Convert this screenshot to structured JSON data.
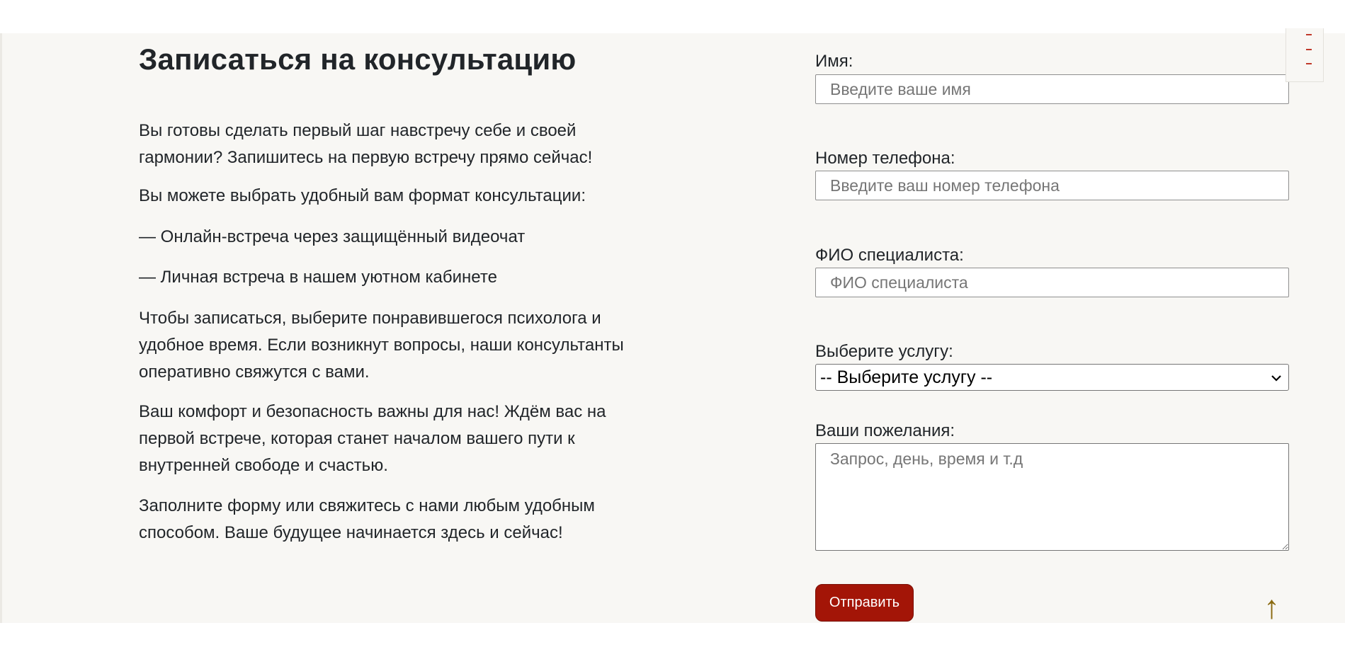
{
  "section": {
    "title": "Записаться на консультацию",
    "paragraphs": [
      "Вы готовы сделать первый шаг навстречу себе и своей гармонии? Запишитесь на первую встречу прямо сейчас!",
      "Вы можете выбрать удобный вам формат консультации:",
      "— Онлайн-встреча через защищённый видеочат",
      "— Личная встреча в нашем уютном кабинете",
      "Чтобы записаться, выберите понравившегося психолога и удобное время. Если возникнут вопросы, наши консультанты оперативно свяжутся с вами.",
      "Ваш комфорт и безопасность важны для нас! Ждём вас на первой встрече, которая станет началом вашего пути к внутренней свободе и счастью.",
      "Заполните форму или свяжитесь с нами любым удобным способом. Ваше будущее начинается здесь и сейчас!"
    ]
  },
  "form": {
    "name": {
      "label": "Имя:",
      "value": "",
      "placeholder": "Введите ваше имя"
    },
    "phone": {
      "label": "Номер телефона:",
      "value": "",
      "placeholder": "Введите ваш номер телефона"
    },
    "specialist": {
      "label": "ФИО специалиста:",
      "value": "",
      "placeholder": "ФИО специалиста"
    },
    "service": {
      "label": "Выберите услугу:",
      "selected": "-- Выберите услугу --"
    },
    "wishes": {
      "label": "Ваши пожелания:",
      "value": "",
      "placeholder": "Запрос, день, время и т.д"
    },
    "submit_label": "Отправить"
  },
  "icons": {
    "corner_menu": "menu-dashes-icon",
    "scroll_top": "arrow-up-icon",
    "scroll_top_glyph": "↑",
    "select_chevron": "chevron-down-icon"
  },
  "colors": {
    "accent": "#a31507",
    "background": "#f8f7f4",
    "scroll_arrow": "#8a6a10"
  }
}
